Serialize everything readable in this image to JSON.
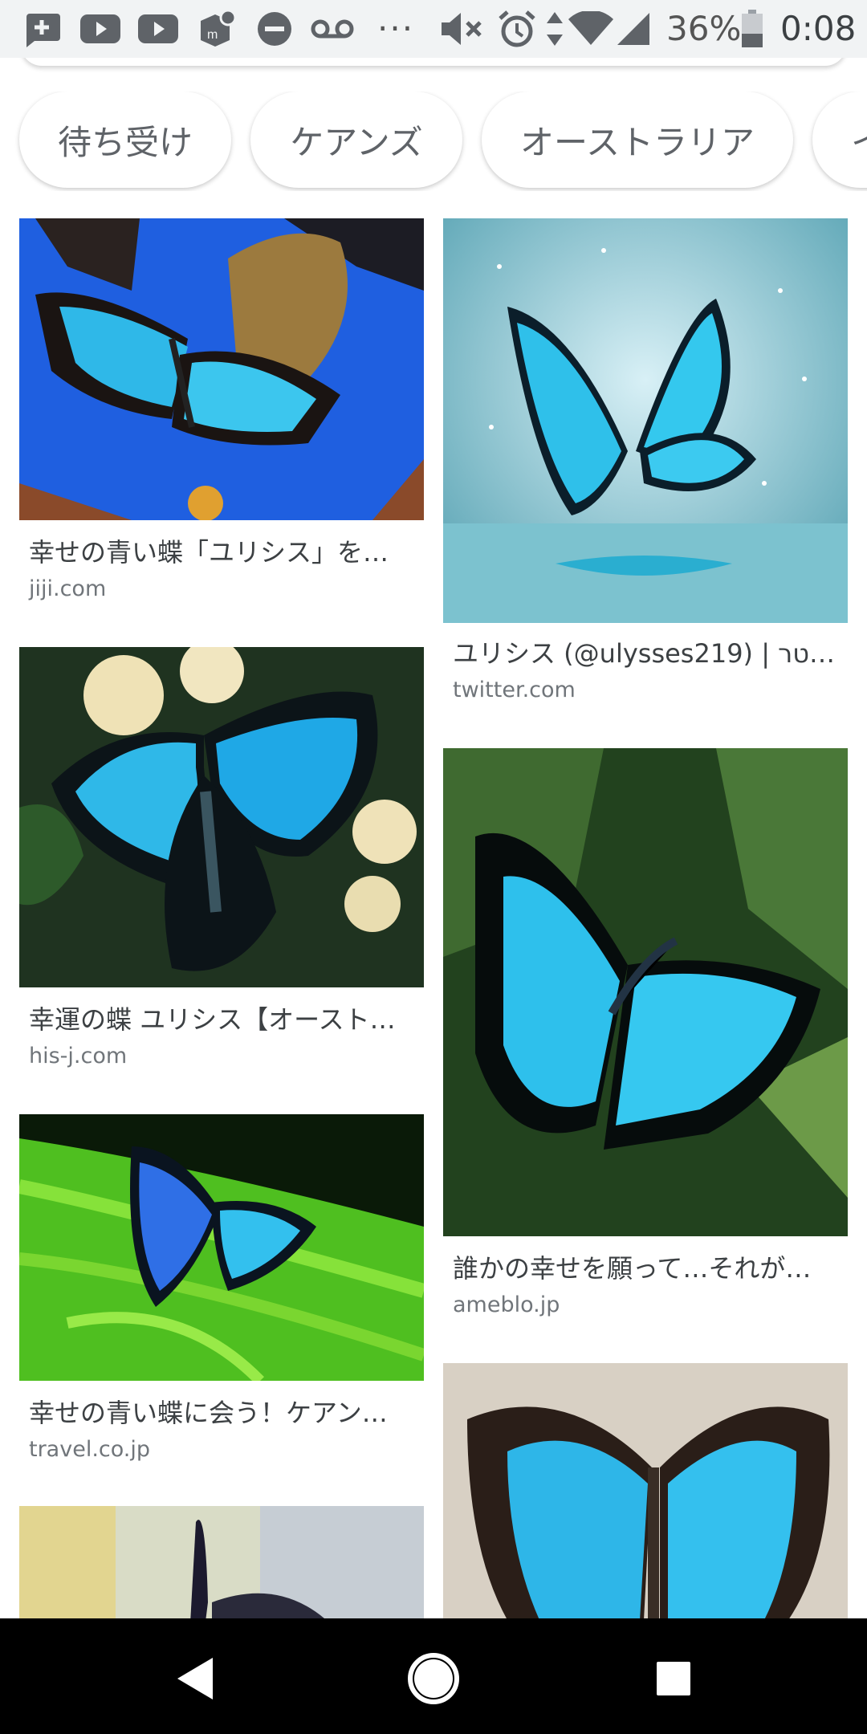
{
  "status_bar": {
    "battery": "36%",
    "time": "0:08",
    "overflow": "···",
    "icons": [
      "chat-plus-icon",
      "youtube-icon",
      "youtube-icon",
      "app-badge-icon",
      "do-not-disturb-icon",
      "voicemail-icon",
      "mute-icon",
      "alarm-icon",
      "data-arrows-icon",
      "wifi-icon",
      "signal-icon",
      "battery-icon"
    ]
  },
  "chips": [
    "待ち受け",
    "ケアンズ",
    "オーストラリア",
    "イ"
  ],
  "results": [
    {
      "title": "幸せの青い蝶「ユリシス」を…",
      "source": "jiji.com"
    },
    {
      "title": "ユリシス (@ulysses219) | ויטר…",
      "source": "twitter.com"
    },
    {
      "title": "幸運の蝶 ユリシス【オースト…",
      "source": "his-j.com"
    },
    {
      "title": "誰かの幸せを願って…それが…",
      "source": "ameblo.jp"
    },
    {
      "title": "幸せの青い蝶に会う！ケアン…",
      "source": "travel.co.jp"
    },
    {
      "title": "",
      "source": ""
    },
    {
      "title": "",
      "source": ""
    }
  ],
  "colors": {
    "status_bar_bg": "#f1f3f4",
    "butterfly_blue": "#2fb8e8",
    "nav_bar_bg": "#000000"
  },
  "nav": {
    "back": "back-icon",
    "home": "home-icon",
    "recents": "recents-icon"
  }
}
